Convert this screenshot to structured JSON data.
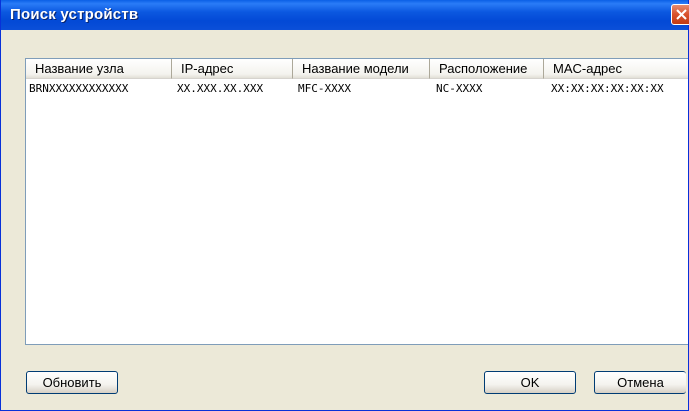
{
  "window": {
    "title": "Поиск устройств"
  },
  "device_list": {
    "columns": [
      "Название узла",
      "IP-адрес",
      "Название модели",
      "Расположение",
      "MAC-адрес"
    ],
    "rows": [
      [
        "BRNXXXXXXXXXXXX",
        "XX.XXX.XX.XXX",
        "MFC-XXXX",
        "NC-XXXX",
        "XX:XX:XX:XX:XX:XX"
      ]
    ]
  },
  "buttons": {
    "refresh": "Обновить",
    "ok": "OK",
    "cancel": "Отмена"
  },
  "icons": {
    "close": "close-icon"
  }
}
